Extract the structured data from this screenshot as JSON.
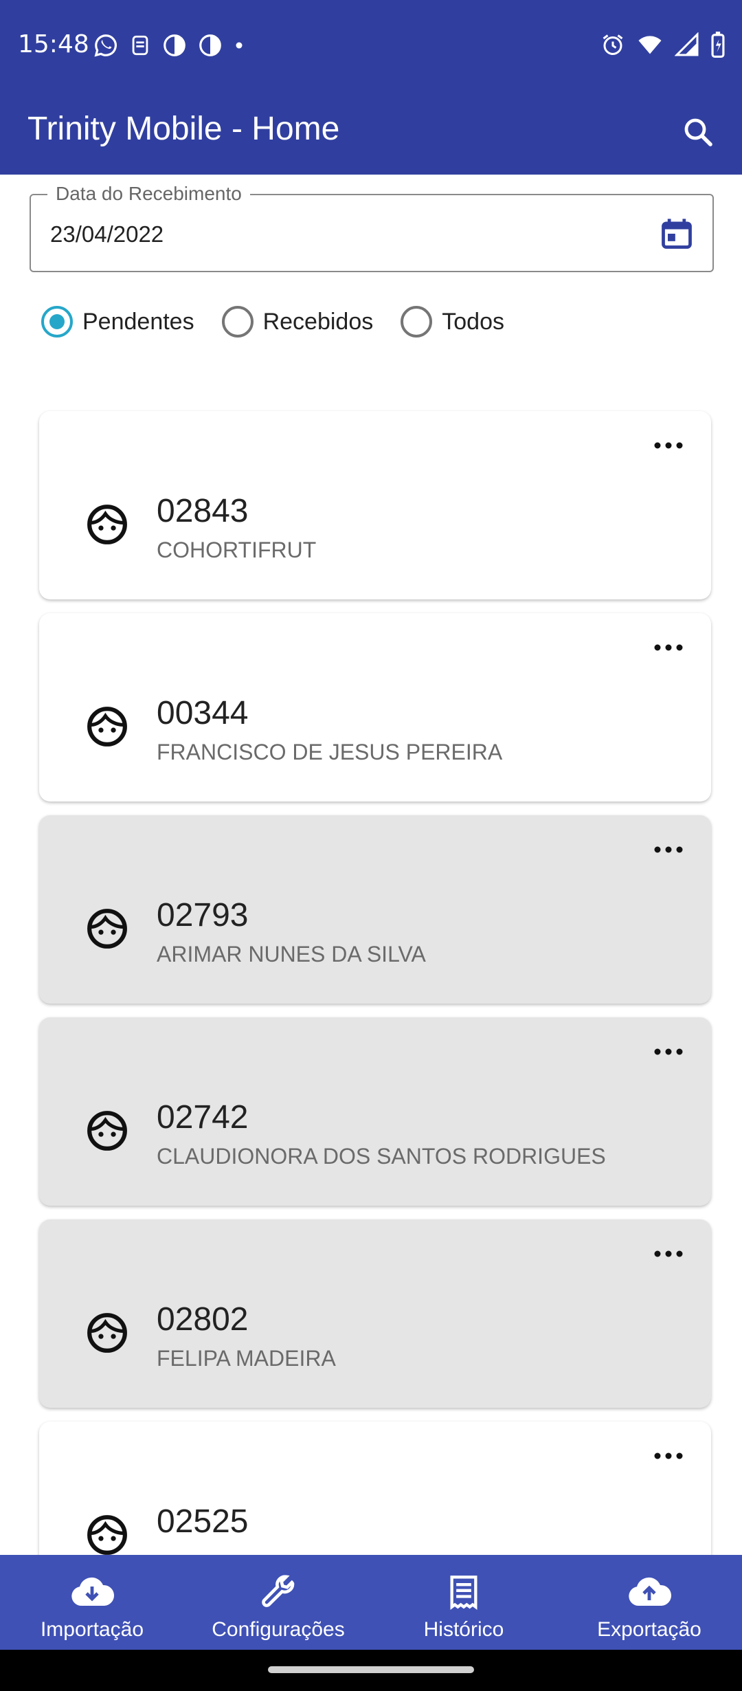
{
  "status_bar": {
    "time": "15:48",
    "left_icons": [
      "whatsapp-icon",
      "notification-icon",
      "half-moon-icon",
      "half-moon-icon",
      "dot-icon"
    ],
    "right_icons": [
      "alarm-icon",
      "wifi-icon",
      "signal-icon",
      "battery-charging-icon"
    ]
  },
  "app_bar": {
    "title": "Trinity Mobile - Home",
    "search_icon": "search-icon"
  },
  "date_field": {
    "label": "Data do Recebimento",
    "value": "23/04/2022",
    "icon": "calendar-icon"
  },
  "filters": [
    {
      "label": "Pendentes",
      "checked": true
    },
    {
      "label": "Recebidos",
      "checked": false
    },
    {
      "label": "Todos",
      "checked": false
    }
  ],
  "items": [
    {
      "code": "02843",
      "name": "COHORTIFRUT",
      "highlighted": false
    },
    {
      "code": "00344",
      "name": "FRANCISCO DE JESUS PEREIRA",
      "highlighted": false
    },
    {
      "code": "02793",
      "name": "ARIMAR NUNES DA SILVA",
      "highlighted": true
    },
    {
      "code": "02742",
      "name": "CLAUDIONORA DOS SANTOS RODRIGUES",
      "highlighted": true
    },
    {
      "code": "02802",
      "name": "FELIPA MADEIRA",
      "highlighted": true
    },
    {
      "code": "02525",
      "name": "",
      "highlighted": false
    }
  ],
  "bottom_nav": [
    {
      "label": "Importação",
      "icon": "download-cloud-icon"
    },
    {
      "label": "Configurações",
      "icon": "wrench-icon"
    },
    {
      "label": "Histórico",
      "icon": "receipt-icon"
    },
    {
      "label": "Exportação",
      "icon": "upload-cloud-icon"
    }
  ],
  "colors": {
    "primary": "#303f9f",
    "nav": "#3f51b5",
    "accent": "#26a7c9",
    "card_highlight": "#e5e5e5"
  }
}
